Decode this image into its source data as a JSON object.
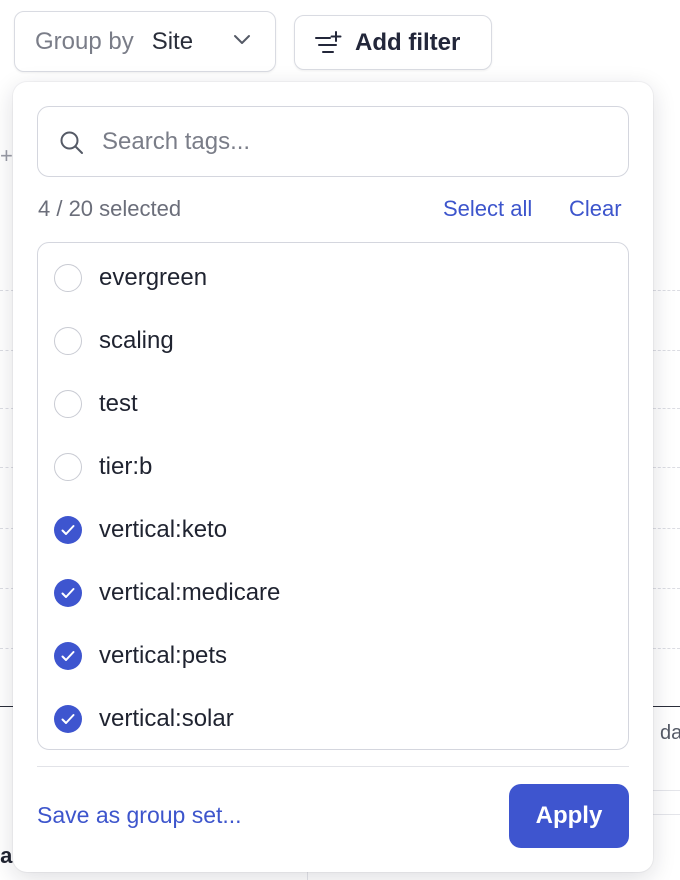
{
  "toolbar": {
    "group_by_label": "Group by",
    "group_by_value": "Site",
    "group_by_icon": "chevron-down-icon",
    "add_filter_label": "Add filter",
    "add_filter_icon": "filter-add-icon"
  },
  "popover": {
    "search_placeholder": "Search tags...",
    "search_value": "",
    "search_icon": "search-icon",
    "selected_count": "4 / 20 selected",
    "select_all_label": "Select all",
    "clear_label": "Clear",
    "tags": [
      {
        "label": "evergreen",
        "checked": false
      },
      {
        "label": "scaling",
        "checked": false
      },
      {
        "label": "test",
        "checked": false
      },
      {
        "label": "tier:b",
        "checked": false
      },
      {
        "label": "vertical:keto",
        "checked": true
      },
      {
        "label": "vertical:medicare",
        "checked": true
      },
      {
        "label": "vertical:pets",
        "checked": true
      },
      {
        "label": "vertical:solar",
        "checked": true
      }
    ],
    "save_group_set_label": "Save as group set...",
    "apply_label": "Apply"
  },
  "background": {
    "right_fragment_text": "da",
    "bottom_left_fragment_text": "la"
  },
  "colors": {
    "accent": "#3e55cf",
    "link": "#3d55cc",
    "border": "#d4d6de",
    "muted_text": "#6b6e7a"
  }
}
